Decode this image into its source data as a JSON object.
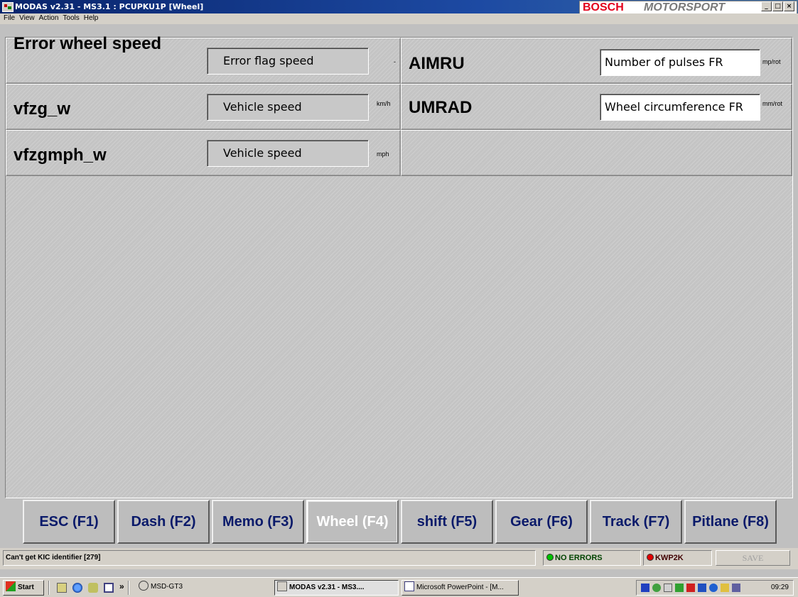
{
  "window": {
    "title": "MODAS v2.31 - MS3.1 : PCUPKU1P   [Wheel]",
    "brand_left": "BOSCH",
    "brand_right": "MOTORSPORT",
    "btn_min": "_",
    "btn_max": "□",
    "btn_close": "×"
  },
  "menu": [
    "File",
    "View",
    "Action",
    "Tools",
    "Help"
  ],
  "vars": {
    "error_wheel_speed": {
      "name": "Error wheel speed",
      "value": "Error flag speed",
      "unit": "-"
    },
    "vfzg_w": {
      "name": "vfzg_w",
      "value": "Vehicle speed",
      "unit": "km/h"
    },
    "vfzgmph_w": {
      "name": "vfzgmph_w",
      "value": "Vehicle speed",
      "unit": "mph"
    },
    "aimru": {
      "name": "AIMRU",
      "value": "Number of pulses FR",
      "unit": "mp/rot"
    },
    "umrad": {
      "name": "UMRAD",
      "value": "Wheel circumference FR",
      "unit": "mm/rot"
    }
  },
  "fkeys": [
    "ESC (F1)",
    "Dash (F2)",
    "Memo (F3)",
    "Wheel  (F4)",
    "shift  (F5)",
    "Gear  (F6)",
    "Track  (F7)",
    "Pitlane (F8)"
  ],
  "active_fkey": "Wheel  (F4)",
  "status": {
    "message": "Can't get KIC identifier [279]",
    "errors": "NO ERRORS",
    "protocol": "KWP2K",
    "save": "SAVE",
    "errors_color": "#00c000",
    "protocol_color": "#e00000"
  },
  "taskbar": {
    "start": "Start",
    "quick_more": "»",
    "items": [
      "MSD-GT3",
      "MODAS v2.31 - MS3....",
      "Microsoft PowerPoint - [M..."
    ],
    "clock": "09:29"
  }
}
